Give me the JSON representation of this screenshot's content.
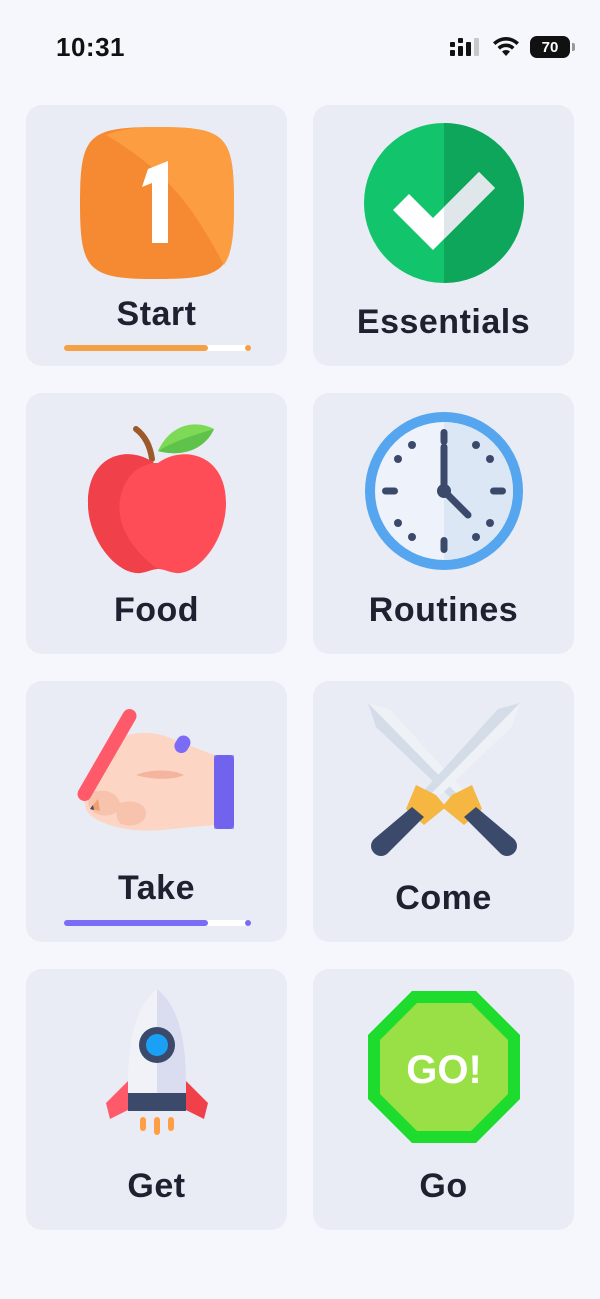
{
  "status_bar": {
    "time": "10:31",
    "battery": "70",
    "icons": [
      "signal-icon",
      "wifi-icon",
      "battery-icon"
    ]
  },
  "categories": [
    {
      "label": "Start",
      "icon": "number-one-icon",
      "progress": 0.78,
      "accent": "#f5a042"
    },
    {
      "label": "Essentials",
      "icon": "checkmark-icon"
    },
    {
      "label": "Food",
      "icon": "apple-icon"
    },
    {
      "label": "Routines",
      "icon": "clock-icon"
    },
    {
      "label": "Take",
      "icon": "hand-writing-icon",
      "progress": 0.78,
      "accent": "#7b6cf6"
    },
    {
      "label": "Come",
      "icon": "crossed-swords-icon"
    },
    {
      "label": "Get",
      "icon": "rocket-icon"
    },
    {
      "label": "Go",
      "icon": "go-sign-icon",
      "sign_text": "GO!"
    }
  ]
}
